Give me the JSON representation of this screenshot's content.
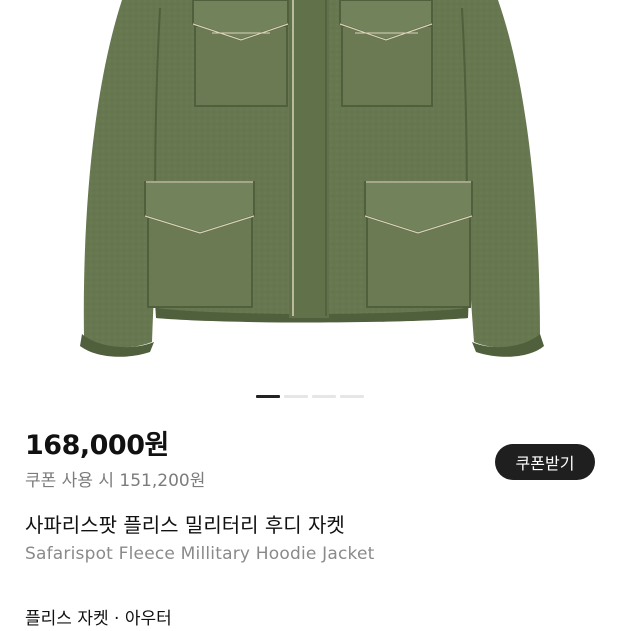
{
  "product": {
    "image_name": "olive fleece military jacket",
    "colors": {
      "fabric": "#67774f",
      "fabric_dark": "#505f3c",
      "fabric_light": "#75855c",
      "trim": "#d9d2b8"
    }
  },
  "carousel": {
    "active_index": 0,
    "count": 4
  },
  "price": {
    "main": "168,000원",
    "coupon": "쿠폰 사용 시 151,200원"
  },
  "actions": {
    "coupon_button": "쿠폰받기"
  },
  "title": {
    "korean": "사파리스팟 플리스 밀리터리 후디 자켓",
    "english": "Safarispot Fleece Millitary Hoodie Jacket"
  },
  "category": "플리스 자켓 · 아우터"
}
